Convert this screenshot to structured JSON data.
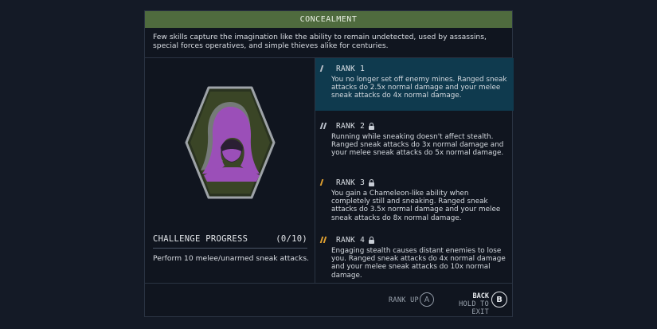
{
  "skill": {
    "title": "CONCEALMENT",
    "description": "Few skills capture the imagination like the ability to remain undetected, used by assassins, special forces operatives, and simple thieves alike for centuries.",
    "emblem_icon": "hooded-figure-icon",
    "colors": {
      "header": "#4f6b3e",
      "active_rank": "#0f3a4e",
      "rank_pip": "#e0a030",
      "rank_pip_base": "#b8bec8",
      "emblem_bg": "#3a4526",
      "hood": "#9b4fb8"
    }
  },
  "challenge": {
    "title": "CHALLENGE PROGRESS",
    "progress": "(0/10)",
    "task": "Perform 10 melee/unarmed sneak attacks."
  },
  "ranks": [
    {
      "label": "RANK 1",
      "locked": false,
      "active": true,
      "text": "You no longer set off enemy mines. Ranged sneak attacks do 2.5x normal damage and your melee sneak attacks do 4x normal damage."
    },
    {
      "label": "RANK 2",
      "locked": true,
      "active": false,
      "text": "Running while sneaking doesn't affect stealth. Ranged sneak attacks do 3x normal damage and your melee sneak attacks do 5x normal damage."
    },
    {
      "label": "RANK 3",
      "locked": true,
      "active": false,
      "text": "You gain a Chameleon-like ability when completely still and sneaking. Ranged sneak attacks do 3.5x normal damage and your melee sneak attacks do 8x normal damage."
    },
    {
      "label": "RANK 4",
      "locked": true,
      "active": false,
      "text": "Engaging stealth causes distant enemies to lose you. Ranged sneak attacks do 4x normal damage and your melee sneak attacks do 10x normal damage."
    }
  ],
  "footer": {
    "rank_up_label": "RANK UP",
    "rank_up_key": "A",
    "back_label": "BACK",
    "hold_label": "HOLD TO EXIT",
    "back_key": "B"
  }
}
